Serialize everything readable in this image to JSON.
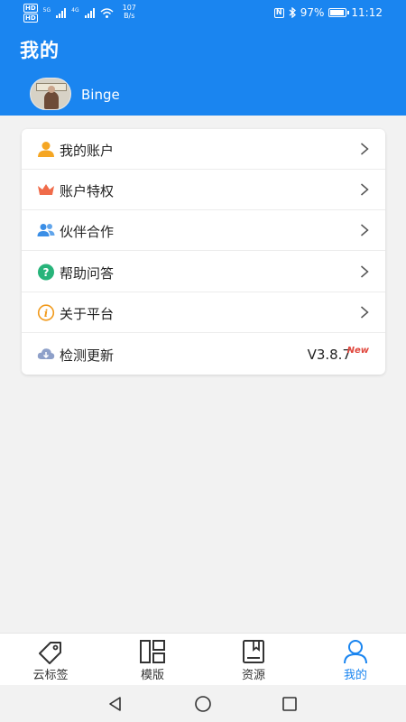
{
  "status_bar": {
    "hd1": "HD",
    "hd2": "HD",
    "net1": "5G",
    "net2": "4G",
    "speed_value": "107",
    "speed_unit": "B/s",
    "battery": "97%",
    "battery_level": 0.97,
    "time": "11:12"
  },
  "header": {
    "title": "我的",
    "username": "Binge"
  },
  "menu": [
    {
      "label": "我的账户",
      "icon": "user-icon",
      "color": "#f5a623"
    },
    {
      "label": "账户特权",
      "icon": "crown-icon",
      "color": "#f06b4a"
    },
    {
      "label": "伙伴合作",
      "icon": "partners-icon",
      "color": "#3a8ee6"
    },
    {
      "label": "帮助问答",
      "icon": "question-icon",
      "color": "#27b47a"
    },
    {
      "label": "关于平台",
      "icon": "info-icon",
      "color": "#f19a1c"
    },
    {
      "label": "检测更新",
      "icon": "cloud-download-icon",
      "color": "#8ea0c9"
    }
  ],
  "update": {
    "version": "V3.8.7",
    "badge": "New"
  },
  "tabs": [
    {
      "label": "云标签",
      "icon": "tag-icon"
    },
    {
      "label": "模版",
      "icon": "template-icon"
    },
    {
      "label": "资源",
      "icon": "resource-icon"
    },
    {
      "label": "我的",
      "icon": "profile-icon",
      "active": true
    }
  ],
  "colors": {
    "brand": "#1a85f0",
    "background": "#f2f2f2"
  }
}
